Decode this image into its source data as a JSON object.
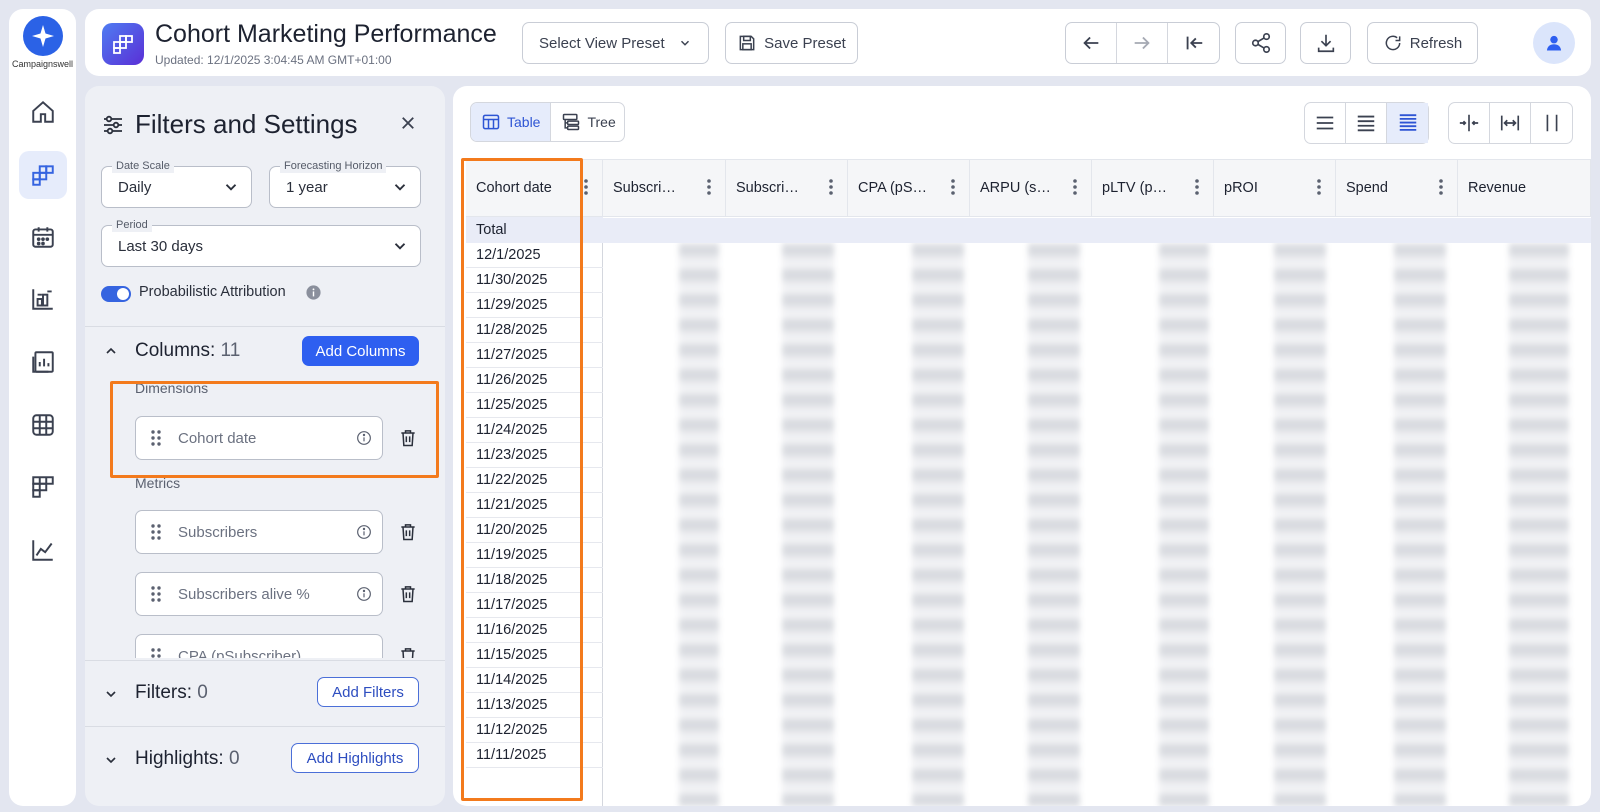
{
  "brand": {
    "name": "Campaignswell"
  },
  "header": {
    "title": "Cohort Marketing Performance",
    "updated": "Updated: 12/1/2025 3:04:45 AM GMT+01:00",
    "view_preset_placeholder": "Select View Preset",
    "save_preset_label": "Save Preset",
    "refresh_label": "Refresh"
  },
  "panel": {
    "title": "Filters and Settings",
    "date_scale": {
      "label": "Date Scale",
      "value": "Daily"
    },
    "forecasting_horizon": {
      "label": "Forecasting Horizon",
      "value": "1 year"
    },
    "period": {
      "label": "Period",
      "value": "Last 30 days"
    },
    "probabilistic_attribution": {
      "label": "Probabilistic Attribution",
      "enabled": true
    },
    "columns": {
      "title": "Columns:",
      "count": "11",
      "add_label": "Add Columns",
      "dimensions_label": "Dimensions",
      "dimensions": [
        "Cohort date"
      ],
      "metrics_label": "Metrics",
      "metrics": [
        "Subscribers",
        "Subscribers alive %",
        "CPA (pSubscriber)"
      ]
    },
    "filters": {
      "title": "Filters:",
      "count": "0",
      "add_label": "Add Filters"
    },
    "highlights": {
      "title": "Highlights:",
      "count": "0",
      "add_label": "Add Highlights"
    }
  },
  "view": {
    "tabs": [
      {
        "label": "Table",
        "active": true
      },
      {
        "label": "Tree",
        "active": false
      }
    ]
  },
  "table": {
    "columns": [
      "Cohort date",
      "Subscri…",
      "Subscri…",
      "CPA (pS…",
      "ARPU (s…",
      "pLTV (p…",
      "pROI",
      "Spend",
      "Revenue"
    ],
    "total_label": "Total",
    "dates": [
      "12/1/2025",
      "11/30/2025",
      "11/29/2025",
      "11/28/2025",
      "11/27/2025",
      "11/26/2025",
      "11/25/2025",
      "11/24/2025",
      "11/23/2025",
      "11/22/2025",
      "11/21/2025",
      "11/20/2025",
      "11/19/2025",
      "11/18/2025",
      "11/17/2025",
      "11/16/2025",
      "11/15/2025",
      "11/14/2025",
      "11/13/2025",
      "11/12/2025",
      "11/11/2025"
    ]
  },
  "colors": {
    "accent": "#2e5ff0",
    "highlight": "#f37a1c",
    "background": "#e3e6f0"
  }
}
